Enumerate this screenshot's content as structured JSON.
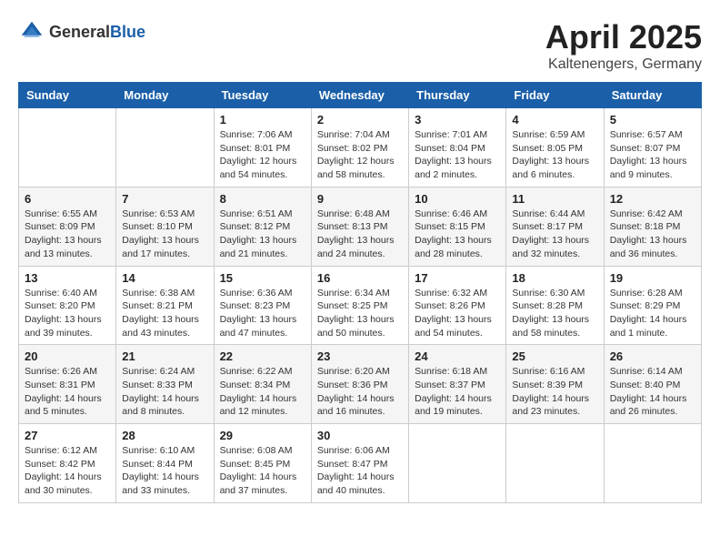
{
  "header": {
    "logo_general": "General",
    "logo_blue": "Blue",
    "month_title": "April 2025",
    "location": "Kaltenengers, Germany"
  },
  "days_of_week": [
    "Sunday",
    "Monday",
    "Tuesday",
    "Wednesday",
    "Thursday",
    "Friday",
    "Saturday"
  ],
  "weeks": [
    [
      {
        "day": "",
        "info": ""
      },
      {
        "day": "",
        "info": ""
      },
      {
        "day": "1",
        "info": "Sunrise: 7:06 AM\nSunset: 8:01 PM\nDaylight: 12 hours and 54 minutes."
      },
      {
        "day": "2",
        "info": "Sunrise: 7:04 AM\nSunset: 8:02 PM\nDaylight: 12 hours and 58 minutes."
      },
      {
        "day": "3",
        "info": "Sunrise: 7:01 AM\nSunset: 8:04 PM\nDaylight: 13 hours and 2 minutes."
      },
      {
        "day": "4",
        "info": "Sunrise: 6:59 AM\nSunset: 8:05 PM\nDaylight: 13 hours and 6 minutes."
      },
      {
        "day": "5",
        "info": "Sunrise: 6:57 AM\nSunset: 8:07 PM\nDaylight: 13 hours and 9 minutes."
      }
    ],
    [
      {
        "day": "6",
        "info": "Sunrise: 6:55 AM\nSunset: 8:09 PM\nDaylight: 13 hours and 13 minutes."
      },
      {
        "day": "7",
        "info": "Sunrise: 6:53 AM\nSunset: 8:10 PM\nDaylight: 13 hours and 17 minutes."
      },
      {
        "day": "8",
        "info": "Sunrise: 6:51 AM\nSunset: 8:12 PM\nDaylight: 13 hours and 21 minutes."
      },
      {
        "day": "9",
        "info": "Sunrise: 6:48 AM\nSunset: 8:13 PM\nDaylight: 13 hours and 24 minutes."
      },
      {
        "day": "10",
        "info": "Sunrise: 6:46 AM\nSunset: 8:15 PM\nDaylight: 13 hours and 28 minutes."
      },
      {
        "day": "11",
        "info": "Sunrise: 6:44 AM\nSunset: 8:17 PM\nDaylight: 13 hours and 32 minutes."
      },
      {
        "day": "12",
        "info": "Sunrise: 6:42 AM\nSunset: 8:18 PM\nDaylight: 13 hours and 36 minutes."
      }
    ],
    [
      {
        "day": "13",
        "info": "Sunrise: 6:40 AM\nSunset: 8:20 PM\nDaylight: 13 hours and 39 minutes."
      },
      {
        "day": "14",
        "info": "Sunrise: 6:38 AM\nSunset: 8:21 PM\nDaylight: 13 hours and 43 minutes."
      },
      {
        "day": "15",
        "info": "Sunrise: 6:36 AM\nSunset: 8:23 PM\nDaylight: 13 hours and 47 minutes."
      },
      {
        "day": "16",
        "info": "Sunrise: 6:34 AM\nSunset: 8:25 PM\nDaylight: 13 hours and 50 minutes."
      },
      {
        "day": "17",
        "info": "Sunrise: 6:32 AM\nSunset: 8:26 PM\nDaylight: 13 hours and 54 minutes."
      },
      {
        "day": "18",
        "info": "Sunrise: 6:30 AM\nSunset: 8:28 PM\nDaylight: 13 hours and 58 minutes."
      },
      {
        "day": "19",
        "info": "Sunrise: 6:28 AM\nSunset: 8:29 PM\nDaylight: 14 hours and 1 minute."
      }
    ],
    [
      {
        "day": "20",
        "info": "Sunrise: 6:26 AM\nSunset: 8:31 PM\nDaylight: 14 hours and 5 minutes."
      },
      {
        "day": "21",
        "info": "Sunrise: 6:24 AM\nSunset: 8:33 PM\nDaylight: 14 hours and 8 minutes."
      },
      {
        "day": "22",
        "info": "Sunrise: 6:22 AM\nSunset: 8:34 PM\nDaylight: 14 hours and 12 minutes."
      },
      {
        "day": "23",
        "info": "Sunrise: 6:20 AM\nSunset: 8:36 PM\nDaylight: 14 hours and 16 minutes."
      },
      {
        "day": "24",
        "info": "Sunrise: 6:18 AM\nSunset: 8:37 PM\nDaylight: 14 hours and 19 minutes."
      },
      {
        "day": "25",
        "info": "Sunrise: 6:16 AM\nSunset: 8:39 PM\nDaylight: 14 hours and 23 minutes."
      },
      {
        "day": "26",
        "info": "Sunrise: 6:14 AM\nSunset: 8:40 PM\nDaylight: 14 hours and 26 minutes."
      }
    ],
    [
      {
        "day": "27",
        "info": "Sunrise: 6:12 AM\nSunset: 8:42 PM\nDaylight: 14 hours and 30 minutes."
      },
      {
        "day": "28",
        "info": "Sunrise: 6:10 AM\nSunset: 8:44 PM\nDaylight: 14 hours and 33 minutes."
      },
      {
        "day": "29",
        "info": "Sunrise: 6:08 AM\nSunset: 8:45 PM\nDaylight: 14 hours and 37 minutes."
      },
      {
        "day": "30",
        "info": "Sunrise: 6:06 AM\nSunset: 8:47 PM\nDaylight: 14 hours and 40 minutes."
      },
      {
        "day": "",
        "info": ""
      },
      {
        "day": "",
        "info": ""
      },
      {
        "day": "",
        "info": ""
      }
    ]
  ]
}
